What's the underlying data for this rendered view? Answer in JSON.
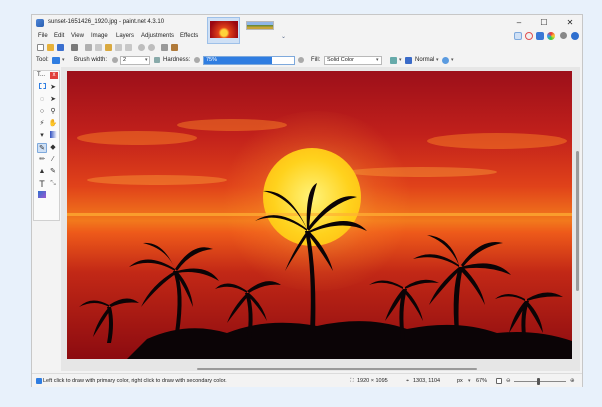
{
  "window": {
    "title": "sunset-1651426_1920.jpg - paint.net 4.3.10",
    "minimize": "–",
    "maximize": "☐",
    "close": "✕",
    "tab_chevron": "⌄"
  },
  "menu": [
    "File",
    "Edit",
    "View",
    "Image",
    "Layers",
    "Adjustments",
    "Effects"
  ],
  "toolbar": {
    "tool_label": "Tool:",
    "brush_width_label": "Brush width:",
    "brush_width_value": "2",
    "hardness_label": "Hardness:",
    "hardness_value": "75%",
    "hardness_fraction": 0.75,
    "fill_label": "Fill:",
    "fill_value": "Solid Color",
    "blend_mode": "Normal"
  },
  "tools_panel": {
    "title": "T...",
    "close": "x"
  },
  "status": {
    "hint": "Left click to draw with primary color, right click to draw with secondary color.",
    "image_size": "1920 × 1095",
    "cursor_position": "1303, 1104",
    "units": "px",
    "zoom": "67%"
  },
  "colors": {
    "accent": "#2f7de1",
    "close_red": "#e0403a"
  }
}
